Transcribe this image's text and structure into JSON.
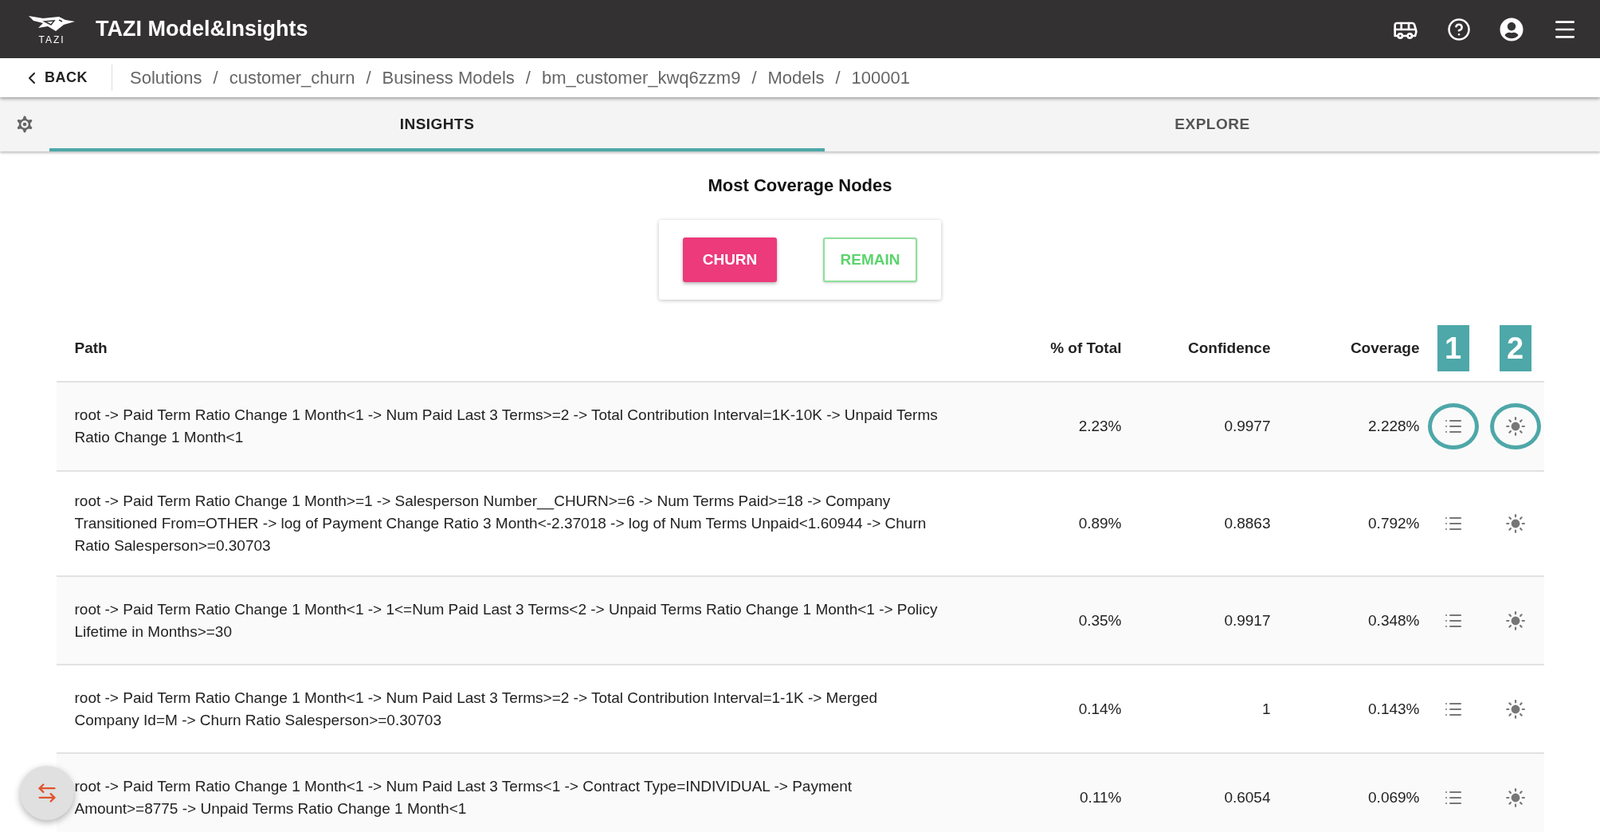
{
  "app": {
    "logo_text": "TAZI",
    "title": "TAZI Model&Insights"
  },
  "nav": {
    "back": "BACK",
    "breadcrumbs": [
      "Solutions",
      "customer_churn",
      "Business Models",
      "bm_customer_kwq6zzm9",
      "Models",
      "100001"
    ],
    "separator": "/"
  },
  "tabs": [
    {
      "label": "INSIGHTS",
      "selected": true
    },
    {
      "label": "EXPLORE",
      "selected": false
    }
  ],
  "section_title": "Most Coverage Nodes",
  "toggle": [
    {
      "label": "CHURN",
      "selected": true
    },
    {
      "label": "REMAIN",
      "selected": false
    }
  ],
  "table": {
    "columns": [
      "Path",
      "% of Total",
      "Confidence",
      "Coverage"
    ],
    "annotations": [
      "1",
      "2"
    ],
    "rows": [
      {
        "path": "root -> Paid Term Ratio Change 1 Month<1 -> Num Paid Last 3 Terms>=2 -> Total Contribution Interval=1K-10K -> Unpaid Terms Ratio Change 1 Month<1",
        "pct": "2.23%",
        "confidence": "0.9977",
        "coverage": "2.228%",
        "highlighted": true
      },
      {
        "path": "root -> Paid Term Ratio Change 1 Month>=1 -> Salesperson Number__CHURN>=6 -> Num Terms Paid>=18 -> Company Transitioned From=OTHER -> log of Payment Change Ratio 3 Month<-2.37018 -> log of Num Terms Unpaid<1.60944 -> Churn Ratio Salesperson>=0.30703",
        "pct": "0.89%",
        "confidence": "0.8863",
        "coverage": "0.792%",
        "highlighted": false
      },
      {
        "path": "root -> Paid Term Ratio Change 1 Month<1 -> 1<=Num Paid Last 3 Terms<2 -> Unpaid Terms Ratio Change 1 Month<1 -> Policy Lifetime in Months>=30",
        "pct": "0.35%",
        "confidence": "0.9917",
        "coverage": "0.348%",
        "highlighted": false
      },
      {
        "path": "root -> Paid Term Ratio Change 1 Month<1 -> Num Paid Last 3 Terms>=2 -> Total Contribution Interval=1-1K -> Merged Company Id=M -> Churn Ratio Salesperson>=0.30703",
        "pct": "0.14%",
        "confidence": "1",
        "coverage": "0.143%",
        "highlighted": false
      },
      {
        "path": "root -> Paid Term Ratio Change 1 Month<1 -> Num Paid Last 3 Terms<1 -> Contract Type=INDIVIDUAL -> Payment Amount>=8775 -> Unpaid Terms Ratio Change 1 Month<1",
        "pct": "0.11%",
        "confidence": "0.6054",
        "coverage": "0.069%",
        "highlighted": false
      }
    ]
  }
}
